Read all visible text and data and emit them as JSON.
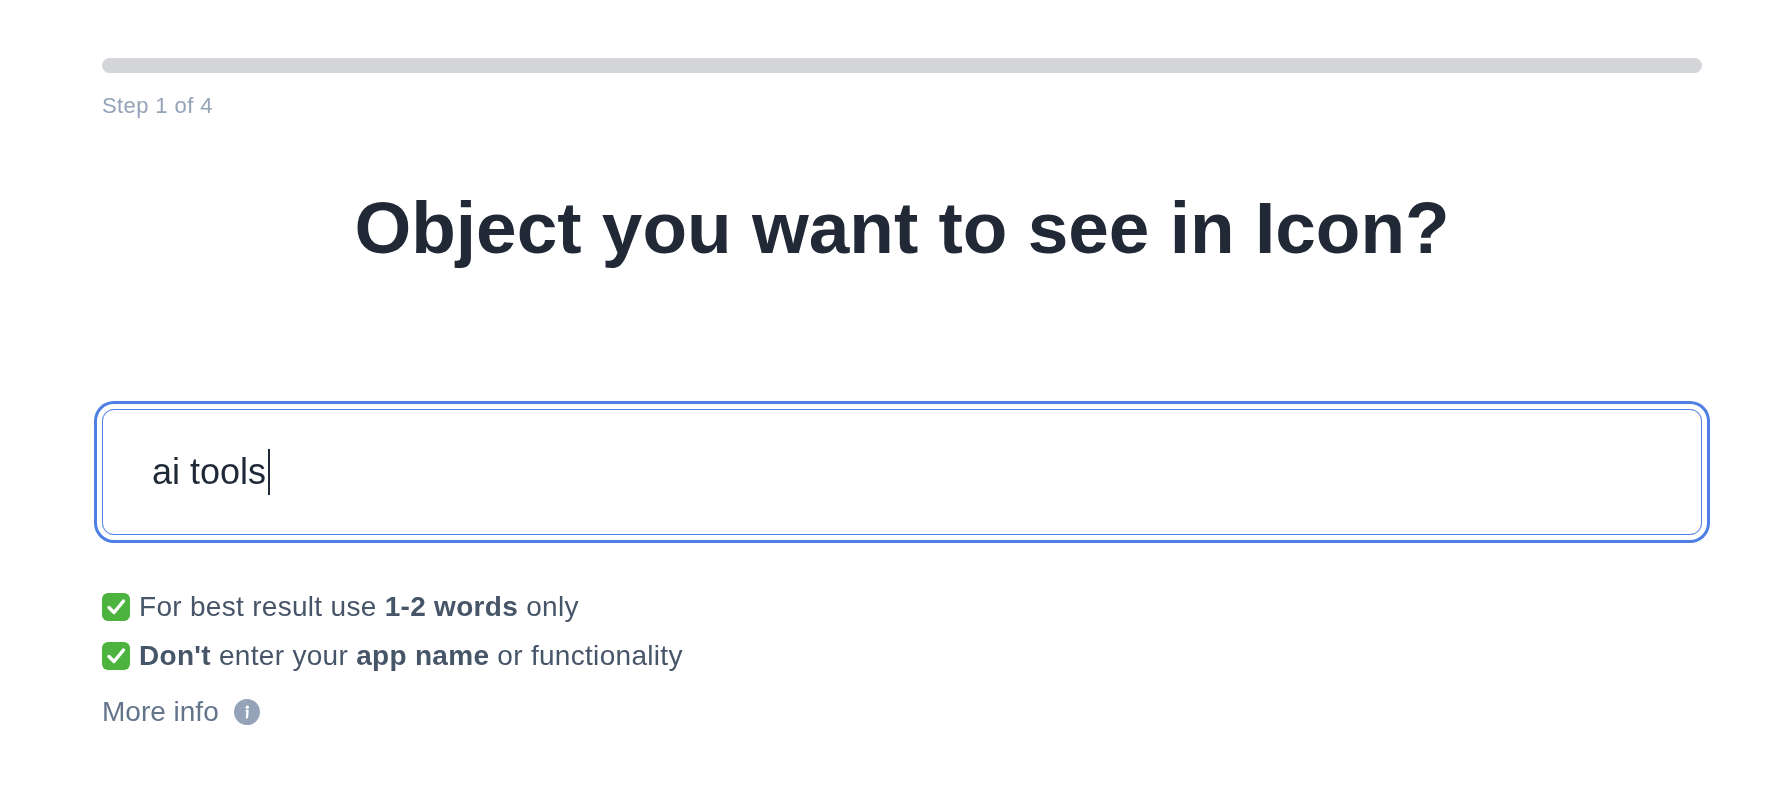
{
  "step_label": "Step 1 of 4",
  "title": "Object you want to see in Icon?",
  "input": {
    "value": "ai tools",
    "focused": true
  },
  "tips": [
    {
      "text": "For best result use **1-2 words** only"
    },
    {
      "text": "**Don't** enter your **app name** or functionality"
    }
  ],
  "more_info": {
    "label": "More info"
  }
}
